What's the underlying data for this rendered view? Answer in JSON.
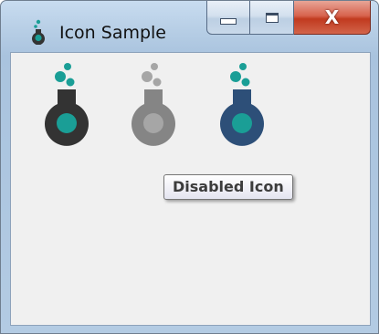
{
  "window": {
    "title": "Icon Sample",
    "caption_buttons": {
      "minimize_icon": "minimize-icon",
      "maximize_icon": "maximize-icon",
      "close_glyph": "X"
    }
  },
  "icons": [
    {
      "name": "flask-icon-normal",
      "state": "normal",
      "body_color": "#333333",
      "liquid_color": "#1a9e96",
      "bubble_color": "#1a9e96"
    },
    {
      "name": "flask-icon-disabled",
      "state": "disabled",
      "body_color": "#858585",
      "liquid_color": "#a6a6a6",
      "bubble_color": "#a6a6a6"
    },
    {
      "name": "flask-icon-blue",
      "state": "normal",
      "body_color": "#2d4f78",
      "liquid_color": "#1a9e96",
      "bubble_color": "#1a9e96"
    }
  ],
  "tooltip": {
    "text": "Disabled Icon"
  },
  "colors": {
    "client_background": "#f0f0f0",
    "close_button": "#c13a1f",
    "titlebar": "#b8cfe6"
  }
}
